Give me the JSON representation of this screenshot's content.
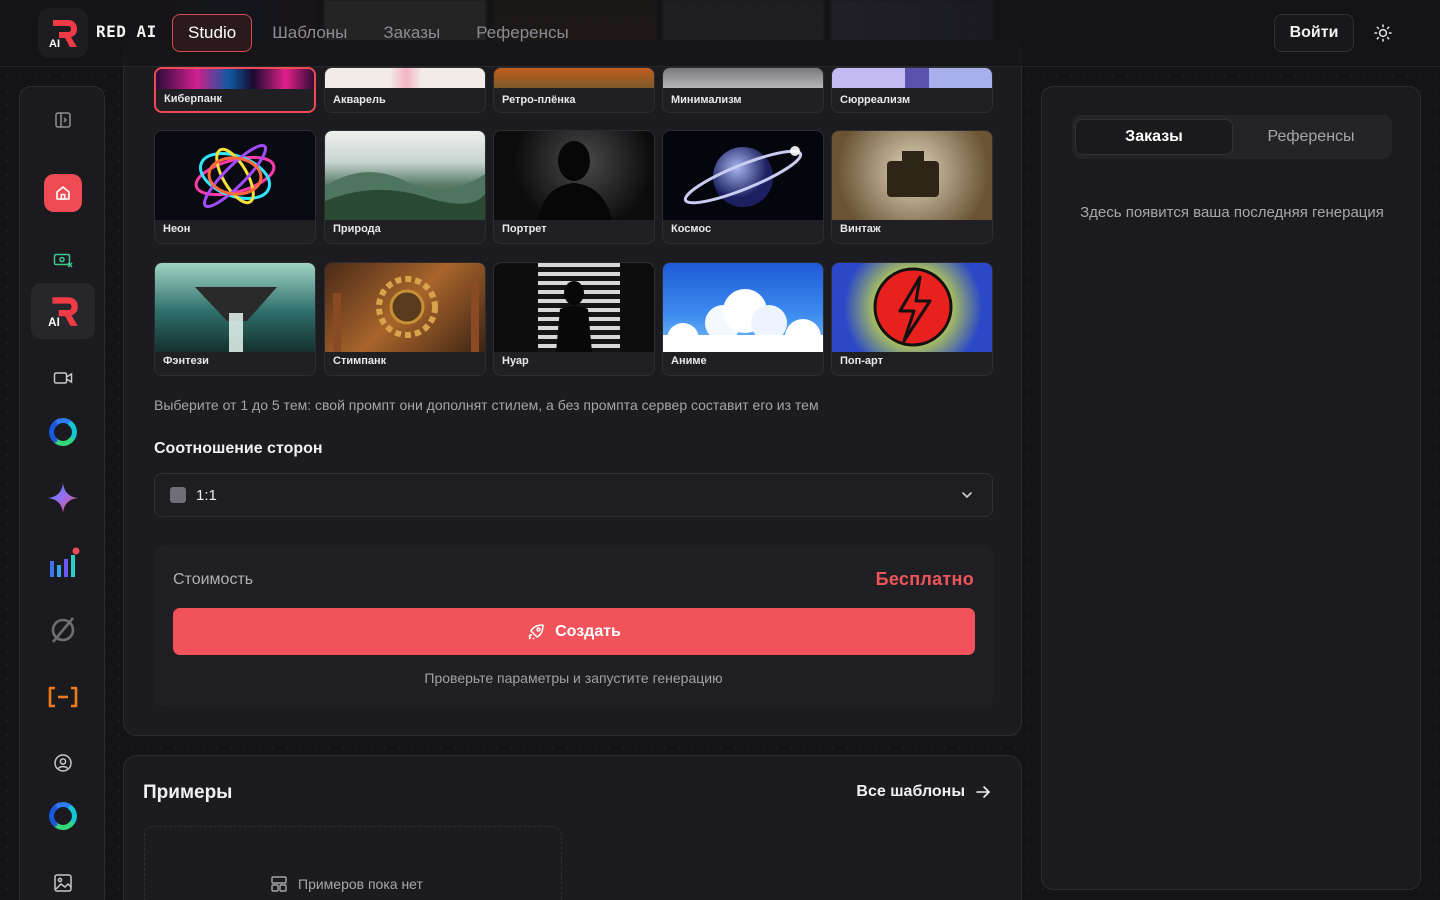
{
  "header": {
    "brand": "RED AI",
    "logo_text": "AI",
    "nav": [
      {
        "label": "Studio"
      },
      {
        "label": "Шаблоны"
      },
      {
        "label": "Заказы"
      },
      {
        "label": "Референсы"
      }
    ],
    "login_label": "Войти",
    "theme_icon": "sun-icon"
  },
  "sidebar": {
    "icons": [
      "panel-toggle-icon",
      "home-icon",
      "money-icon",
      "red-ai-logo",
      "video-icon",
      "ring-logo-icon",
      "sparkle-icon",
      "chart-icon",
      "openai-icon",
      "bracket-icon",
      "user-circle-icon",
      "ring-logo-icon",
      "image-icon"
    ],
    "logo_text": "AI"
  },
  "styles": {
    "top_row": [
      "Киберпанк",
      "Акварель",
      "Ретро-плёнка",
      "Минимализм",
      "Сюрреализм"
    ],
    "row2": [
      "Неон",
      "Природа",
      "Портрет",
      "Космос",
      "Винтаж"
    ],
    "row3": [
      "Фэнтези",
      "Стимпанк",
      "Нуар",
      "Аниме",
      "Поп-арт"
    ],
    "hint": "Выберите от 1 до 5 тем: свой промпт они дополнят стилем, а без промпта сервер составит его из тем"
  },
  "aspect": {
    "title": "Соотношение сторон",
    "value": "1:1"
  },
  "cost": {
    "label": "Стоимость",
    "value": "Бесплатно",
    "button": "Создать",
    "note": "Проверьте параметры и запустите генерацию",
    "accent": "#f2525a"
  },
  "examples": {
    "title": "Примеры",
    "all_link": "Все шаблоны",
    "empty": "Примеров пока нет"
  },
  "right_panel": {
    "tabs": [
      "Заказы",
      "Референсы"
    ],
    "empty": "Здесь появится ваша последняя генерация"
  }
}
